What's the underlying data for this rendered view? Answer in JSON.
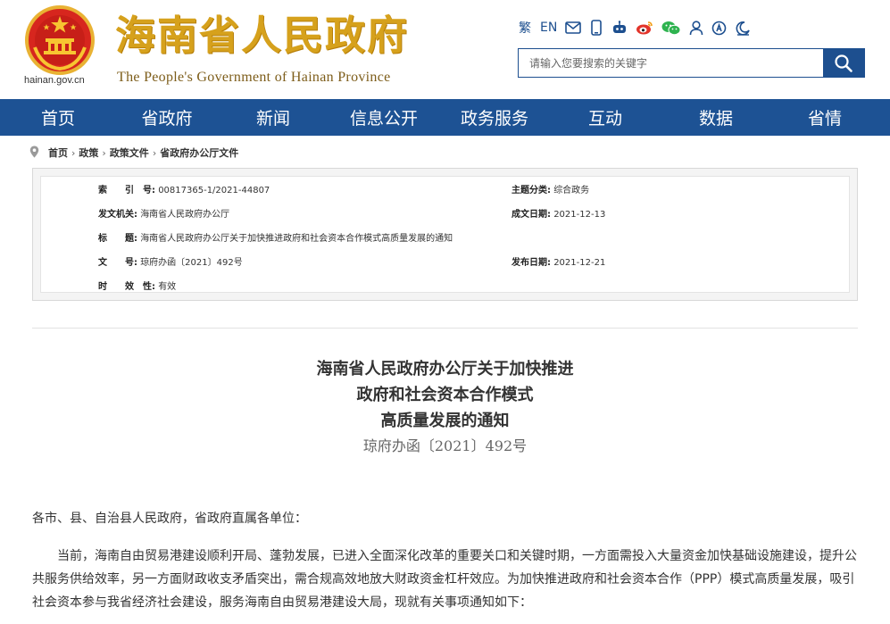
{
  "header": {
    "site_domain": "hainan.gov.cn",
    "logo_cn": "海南省人民政府",
    "logo_en": "The People's Government  of Hainan Province",
    "utility": {
      "traditional": "繁",
      "english": "EN"
    },
    "search_placeholder": "请输入您要搜索的关键字"
  },
  "nav": {
    "items": [
      "首页",
      "省政府",
      "新闻",
      "信息公开",
      "政务服务",
      "互动",
      "数据",
      "省情"
    ]
  },
  "breadcrumb": [
    "首页",
    "政策",
    "政策文件",
    "省政府办公厅文件"
  ],
  "meta": {
    "index_label": "索　　引　号:",
    "index_value": "00817365-1/2021-44807",
    "topic_label": "主题分类:",
    "topic_value": "综合政务",
    "issuer_label": "发文机关:",
    "issuer_value": "海南省人民政府办公厅",
    "created_label": "成文日期:",
    "created_value": "2021-12-13",
    "title_label": "标　　题:",
    "title_value": "海南省人民政府办公厅关于加快推进政府和社会资本合作模式高质量发展的通知",
    "docno_label": "文　　号:",
    "docno_value": "琼府办函〔2021〕492号",
    "published_label": "发布日期:",
    "published_value": "2021-12-21",
    "validity_label": "时　　效　性:",
    "validity_value": "有效"
  },
  "document": {
    "title_line1": "海南省人民政府办公厅关于加快推进",
    "title_line2": "政府和社会资本合作模式",
    "title_line3": "高质量发展的通知",
    "number": "琼府办函〔2021〕492号",
    "salutation": "各市、县、自治县人民政府，省政府直属各单位：",
    "para1_line1": "　　当前，海南自由贸易港建设顺利开局、蓬勃发展，已进入全面深化改革的重要关口和关键时期，一方面需投入大量资金加快基础设施建设，提升公",
    "para1_line2": "共服务供给效率，另一方面财政收支矛盾突出，需合规高效地放大财政资金杠杆效应。为加快推进政府和社会资本合作（PPP）模式高质量发展，吸引",
    "para1_line3": "社会资本参与我省经济社会建设，服务海南自由贸易港建设大局，现就有关事项通知如下："
  },
  "colors": {
    "primary_blue": "#1d5294",
    "logo_gold": "#d6a11c",
    "emblem_red": "#d7261e"
  }
}
